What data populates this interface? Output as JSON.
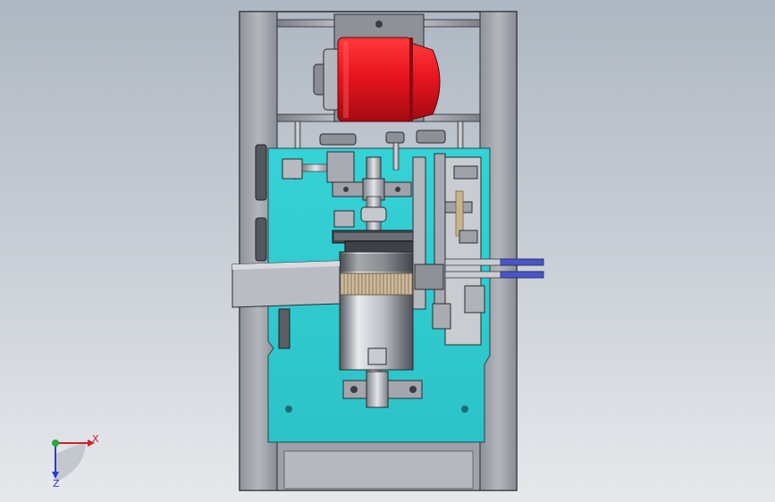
{
  "viewport": {
    "background_top": "#aeb7c2",
    "background_bottom": "#e6e9ec"
  },
  "colors": {
    "frame": "#a3a6ad",
    "frame_dark": "#6d7078",
    "base_plate": "#31cdd2",
    "motor": "#e8141e",
    "steel": "#c9ccd1",
    "brush": "#b8a68a",
    "rod": "#4a55c8"
  },
  "triad": {
    "x_label": "X",
    "z_label": "Z",
    "x_color": "#d0202a",
    "y_color": "#2aa83a",
    "z_color": "#2a3ccc"
  }
}
